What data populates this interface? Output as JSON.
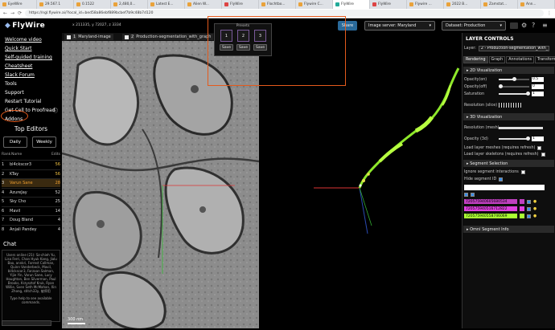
{
  "browser": {
    "tabs": [
      {
        "label": "EyeWire",
        "color": "#e9a23b"
      },
      {
        "label": "29.567.1",
        "color": "#e9a23b"
      },
      {
        "label": "0.1522",
        "color": "#e9a23b"
      },
      {
        "label": "2,480,0...",
        "color": "#e9a23b"
      },
      {
        "label": "Latest E...",
        "color": "#e9a23b"
      },
      {
        "label": "Alien W...",
        "color": "#e9a23b"
      },
      {
        "label": "FlyWire",
        "color": "#d44"
      },
      {
        "label": "Flochtbo...",
        "color": "#e9a23b"
      },
      {
        "label": "Flywire C...",
        "color": "#e9a23b"
      },
      {
        "label": "FlyWire",
        "color": "#2a9"
      },
      {
        "label": "FlyWire",
        "color": "#d44"
      },
      {
        "label": "Flywire ...",
        "color": "#e9a23b"
      },
      {
        "label": "2022 B...",
        "color": "#e9a23b"
      },
      {
        "label": "Zamstat...",
        "color": "#e9a23b"
      },
      {
        "label": "Ann...",
        "color": "#e9a23b"
      }
    ],
    "url": "https://ngl.flywire.ai/?local_id=bed58a86ebf889bcbef7b9c48b7d120"
  },
  "app": {
    "logo": "FlyWire",
    "coords": "x  211335,  y  72027,  z  3334",
    "share_label": "Share",
    "image_server": "Image server: Maryland",
    "dataset": "Dataset: Production"
  },
  "sidebar": {
    "links": [
      "Welcome video",
      "Quick Start",
      "Self-guided training",
      "Cheatsheet",
      "Slack Forum"
    ],
    "plain": [
      "Tools",
      "Support",
      "Restart Tutorial",
      "Get Cell to Proofread",
      "Addons"
    ],
    "top_editors_title": "Top Editors",
    "daily": "Daily",
    "weekly": "Weekly",
    "head_rank": "Rank",
    "head_name": "Name",
    "head_edits": "Edits",
    "editors": [
      {
        "rank": "1",
        "name": "bl4ckscor3",
        "edits": "56"
      },
      {
        "rank": "2",
        "name": "KTay",
        "edits": "56"
      },
      {
        "rank": "3",
        "name": "Varun Sane",
        "edits": "28"
      },
      {
        "rank": "4",
        "name": "AzureJay",
        "edits": "52"
      },
      {
        "rank": "5",
        "name": "Sky Cho",
        "edits": "25"
      },
      {
        "rank": "6",
        "name": "Mavil",
        "edits": "14"
      },
      {
        "rank": "7",
        "name": "Doug Bland",
        "edits": "4"
      },
      {
        "rank": "8",
        "name": "Anjali Pandey",
        "edits": "4"
      }
    ],
    "chat_title": "Chat",
    "chat_online": "Users online (21): Sz-chieh Yu, Lisa Ferri, Chan Hyuk Kang, Jialu Bao, annkri, Forrest Collman, Quinn Vanderbeck, Mavil, bl4ckscor3, Farzaan Salman, Yijie Yin, Varun Sane, Lucy Houghton, Ben Silverman, Paul Brooks, Krzysztof Kruk, Ryan Willie, Sven Seth McMahan, Xin Zhong, stitch33y, 被停用",
    "chat_help": "Type help to see available commands."
  },
  "viewer": {
    "tab1": "Maryland-image",
    "tab2": "Production-segmentation_with_graph",
    "scale": "300 nm"
  },
  "presets": {
    "title": "Presets",
    "slots": [
      "1",
      "2",
      "3"
    ],
    "save": "Save"
  },
  "controls": {
    "title": "LAYER CONTROLS",
    "layer_label": "Layer:",
    "layer_value": "2 - Production-segmentation_with_",
    "tabs": [
      "Rendering",
      "Graph",
      "Annotations",
      "Transform"
    ],
    "sec_2d": "2D Visualization",
    "opacity_on": "Opacity(on)",
    "opacity_on_val": "0.5",
    "opacity_off": "Opacity(off)",
    "opacity_off_val": "0",
    "saturation": "Saturation",
    "saturation_val": "1",
    "resolution_slice": "Resolution (slice)",
    "sec_3d": "3D Visualization",
    "resolution_mesh": "Resolution (mesh)",
    "opacity_3d": "Opacity (3d)",
    "opacity_3d_val": "1",
    "layer_meshes": "Load layer meshes (requires refresh)",
    "layer_skeletons": "Load layer skeletons (requires refresh)",
    "sec_seg": "Segment Selection",
    "ignore": "Ignore segment interactions",
    "hide": "Hide segment ID",
    "segments": [
      {
        "id": "720575940605680534",
        "color": "#c040c0"
      },
      {
        "id": "720575940516712822",
        "color": "#e040e0"
      },
      {
        "id": "720575940558746069",
        "color": "#aaff33"
      }
    ],
    "sec_omni": "Omni Segment Info"
  }
}
